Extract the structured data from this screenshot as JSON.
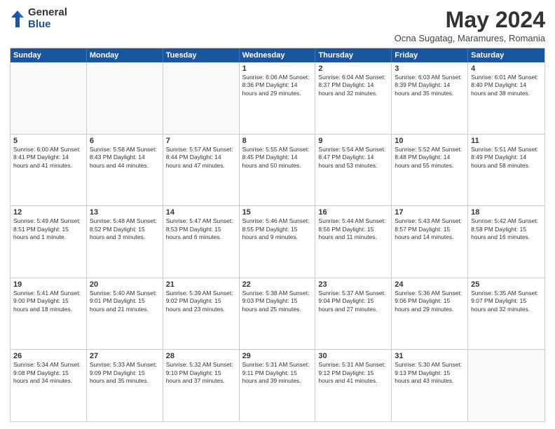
{
  "logo": {
    "general": "General",
    "blue": "Blue"
  },
  "title": "May 2024",
  "location": "Ocna Sugatag, Maramures, Romania",
  "header_days": [
    "Sunday",
    "Monday",
    "Tuesday",
    "Wednesday",
    "Thursday",
    "Friday",
    "Saturday"
  ],
  "weeks": [
    [
      {
        "day": "",
        "empty": true
      },
      {
        "day": "",
        "empty": true
      },
      {
        "day": "",
        "empty": true
      },
      {
        "day": "1",
        "info": "Sunrise: 6:06 AM\nSunset: 8:36 PM\nDaylight: 14 hours\nand 29 minutes."
      },
      {
        "day": "2",
        "info": "Sunrise: 6:04 AM\nSunset: 8:37 PM\nDaylight: 14 hours\nand 32 minutes."
      },
      {
        "day": "3",
        "info": "Sunrise: 6:03 AM\nSunset: 8:39 PM\nDaylight: 14 hours\nand 35 minutes."
      },
      {
        "day": "4",
        "info": "Sunrise: 6:01 AM\nSunset: 8:40 PM\nDaylight: 14 hours\nand 38 minutes."
      }
    ],
    [
      {
        "day": "5",
        "info": "Sunrise: 6:00 AM\nSunset: 8:41 PM\nDaylight: 14 hours\nand 41 minutes."
      },
      {
        "day": "6",
        "info": "Sunrise: 5:58 AM\nSunset: 8:43 PM\nDaylight: 14 hours\nand 44 minutes."
      },
      {
        "day": "7",
        "info": "Sunrise: 5:57 AM\nSunset: 8:44 PM\nDaylight: 14 hours\nand 47 minutes."
      },
      {
        "day": "8",
        "info": "Sunrise: 5:55 AM\nSunset: 8:45 PM\nDaylight: 14 hours\nand 50 minutes."
      },
      {
        "day": "9",
        "info": "Sunrise: 5:54 AM\nSunset: 8:47 PM\nDaylight: 14 hours\nand 53 minutes."
      },
      {
        "day": "10",
        "info": "Sunrise: 5:52 AM\nSunset: 8:48 PM\nDaylight: 14 hours\nand 55 minutes."
      },
      {
        "day": "11",
        "info": "Sunrise: 5:51 AM\nSunset: 8:49 PM\nDaylight: 14 hours\nand 58 minutes."
      }
    ],
    [
      {
        "day": "12",
        "info": "Sunrise: 5:49 AM\nSunset: 8:51 PM\nDaylight: 15 hours\nand 1 minute."
      },
      {
        "day": "13",
        "info": "Sunrise: 5:48 AM\nSunset: 8:52 PM\nDaylight: 15 hours\nand 3 minutes."
      },
      {
        "day": "14",
        "info": "Sunrise: 5:47 AM\nSunset: 8:53 PM\nDaylight: 15 hours\nand 6 minutes."
      },
      {
        "day": "15",
        "info": "Sunrise: 5:46 AM\nSunset: 8:55 PM\nDaylight: 15 hours\nand 9 minutes."
      },
      {
        "day": "16",
        "info": "Sunrise: 5:44 AM\nSunset: 8:56 PM\nDaylight: 15 hours\nand 11 minutes."
      },
      {
        "day": "17",
        "info": "Sunrise: 5:43 AM\nSunset: 8:57 PM\nDaylight: 15 hours\nand 14 minutes."
      },
      {
        "day": "18",
        "info": "Sunrise: 5:42 AM\nSunset: 8:58 PM\nDaylight: 15 hours\nand 16 minutes."
      }
    ],
    [
      {
        "day": "19",
        "info": "Sunrise: 5:41 AM\nSunset: 9:00 PM\nDaylight: 15 hours\nand 18 minutes."
      },
      {
        "day": "20",
        "info": "Sunrise: 5:40 AM\nSunset: 9:01 PM\nDaylight: 15 hours\nand 21 minutes."
      },
      {
        "day": "21",
        "info": "Sunrise: 5:39 AM\nSunset: 9:02 PM\nDaylight: 15 hours\nand 23 minutes."
      },
      {
        "day": "22",
        "info": "Sunrise: 5:38 AM\nSunset: 9:03 PM\nDaylight: 15 hours\nand 25 minutes."
      },
      {
        "day": "23",
        "info": "Sunrise: 5:37 AM\nSunset: 9:04 PM\nDaylight: 15 hours\nand 27 minutes."
      },
      {
        "day": "24",
        "info": "Sunrise: 5:36 AM\nSunset: 9:06 PM\nDaylight: 15 hours\nand 29 minutes."
      },
      {
        "day": "25",
        "info": "Sunrise: 5:35 AM\nSunset: 9:07 PM\nDaylight: 15 hours\nand 32 minutes."
      }
    ],
    [
      {
        "day": "26",
        "info": "Sunrise: 5:34 AM\nSunset: 9:08 PM\nDaylight: 15 hours\nand 34 minutes."
      },
      {
        "day": "27",
        "info": "Sunrise: 5:33 AM\nSunset: 9:09 PM\nDaylight: 15 hours\nand 35 minutes."
      },
      {
        "day": "28",
        "info": "Sunrise: 5:32 AM\nSunset: 9:10 PM\nDaylight: 15 hours\nand 37 minutes."
      },
      {
        "day": "29",
        "info": "Sunrise: 5:31 AM\nSunset: 9:11 PM\nDaylight: 15 hours\nand 39 minutes."
      },
      {
        "day": "30",
        "info": "Sunrise: 5:31 AM\nSunset: 9:12 PM\nDaylight: 15 hours\nand 41 minutes."
      },
      {
        "day": "31",
        "info": "Sunrise: 5:30 AM\nSunset: 9:13 PM\nDaylight: 15 hours\nand 43 minutes."
      },
      {
        "day": "",
        "empty": true
      }
    ]
  ]
}
